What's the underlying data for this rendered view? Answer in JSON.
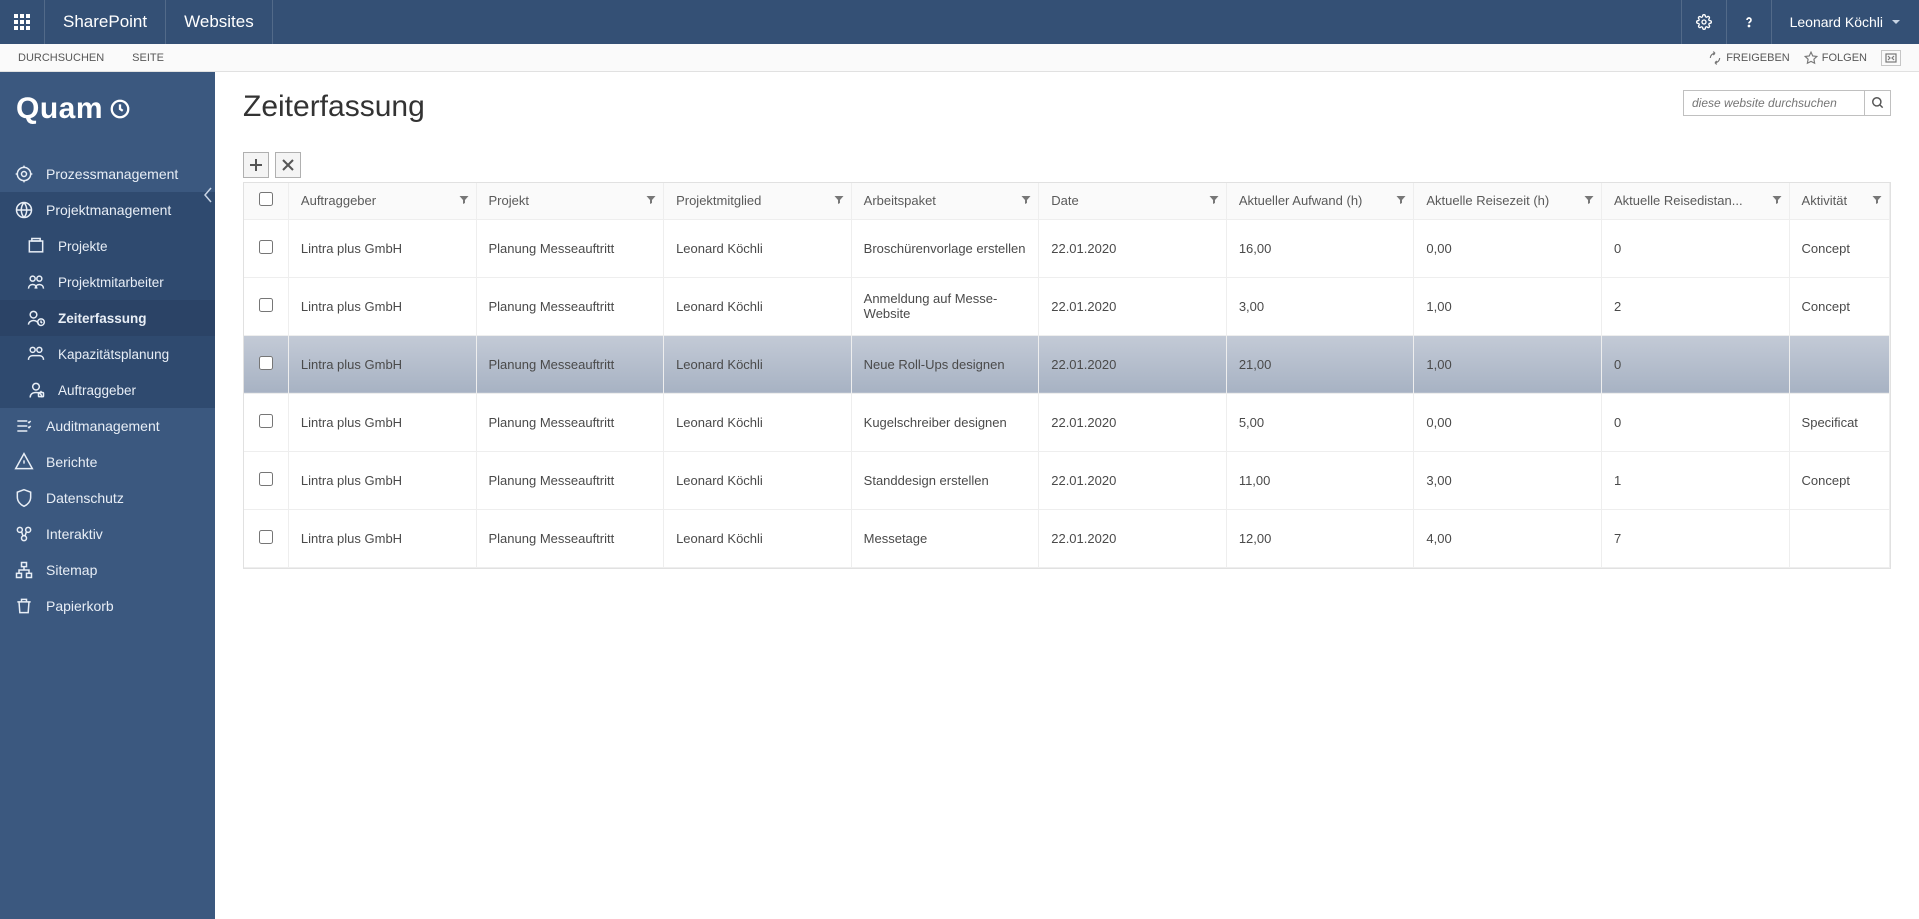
{
  "suite": {
    "app": "SharePoint",
    "section": "Websites",
    "user": "Leonard Köchli"
  },
  "ribbon": {
    "tabs": [
      "DURCHSUCHEN",
      "SEITE"
    ],
    "share": "FREIGEBEN",
    "follow": "FOLGEN"
  },
  "brand": "Quam",
  "nav": {
    "items": [
      {
        "label": "Prozessmanagement",
        "type": "top"
      },
      {
        "label": "Projektmanagement",
        "type": "group-selected"
      },
      {
        "label": "Projekte",
        "type": "sub"
      },
      {
        "label": "Projektmitarbeiter",
        "type": "sub"
      },
      {
        "label": "Zeiterfassung",
        "type": "sub-active"
      },
      {
        "label": "Kapazitätsplanung",
        "type": "sub"
      },
      {
        "label": "Auftraggeber",
        "type": "sub"
      },
      {
        "label": "Auditmanagement",
        "type": "top"
      },
      {
        "label": "Berichte",
        "type": "top"
      },
      {
        "label": "Datenschutz",
        "type": "top"
      },
      {
        "label": "Interaktiv",
        "type": "top"
      },
      {
        "label": "Sitemap",
        "type": "top"
      },
      {
        "label": "Papierkorb",
        "type": "top"
      }
    ]
  },
  "page": {
    "title": "Zeiterfassung",
    "search_placeholder": "diese website durchsuchen"
  },
  "table": {
    "columns": [
      "Auftraggeber",
      "Projekt",
      "Projektmitglied",
      "Arbeitspaket",
      "Date",
      "Aktueller Aufwand (h)",
      "Aktuelle Reisezeit (h)",
      "Aktuelle Reisedistan...",
      "Aktivität"
    ],
    "rows": [
      {
        "auftraggeber": "Lintra plus GmbH",
        "projekt": "Planung Messeauftritt",
        "mitglied": "Leonard Köchli",
        "paket": "Broschürenvorlage erstellen",
        "date": "22.01.2020",
        "aufwand": "16,00",
        "reisezeit": "0,00",
        "reisedist": "0",
        "aktivitaet": "Concept",
        "selected": false
      },
      {
        "auftraggeber": "Lintra plus GmbH",
        "projekt": "Planung Messeauftritt",
        "mitglied": "Leonard Köchli",
        "paket": "Anmeldung auf Messe-Website",
        "date": "22.01.2020",
        "aufwand": "3,00",
        "reisezeit": "1,00",
        "reisedist": "2",
        "aktivitaet": "Concept",
        "selected": false
      },
      {
        "auftraggeber": "Lintra plus GmbH",
        "projekt": "Planung Messeauftritt",
        "mitglied": "Leonard Köchli",
        "paket": "Neue Roll-Ups designen",
        "date": "22.01.2020",
        "aufwand": "21,00",
        "reisezeit": "1,00",
        "reisedist": "0",
        "aktivitaet": "",
        "selected": true
      },
      {
        "auftraggeber": "Lintra plus GmbH",
        "projekt": "Planung Messeauftritt",
        "mitglied": "Leonard Köchli",
        "paket": "Kugelschreiber designen",
        "date": "22.01.2020",
        "aufwand": "5,00",
        "reisezeit": "0,00",
        "reisedist": "0",
        "aktivitaet": "Specificat",
        "selected": false
      },
      {
        "auftraggeber": "Lintra plus GmbH",
        "projekt": "Planung Messeauftritt",
        "mitglied": "Leonard Köchli",
        "paket": "Standdesign erstellen",
        "date": "22.01.2020",
        "aufwand": "11,00",
        "reisezeit": "3,00",
        "reisedist": "1",
        "aktivitaet": "Concept",
        "selected": false
      },
      {
        "auftraggeber": "Lintra plus GmbH",
        "projekt": "Planung Messeauftritt",
        "mitglied": "Leonard Köchli",
        "paket": "Messetage",
        "date": "22.01.2020",
        "aufwand": "12,00",
        "reisezeit": "4,00",
        "reisedist": "7",
        "aktivitaet": "",
        "selected": false
      }
    ]
  }
}
